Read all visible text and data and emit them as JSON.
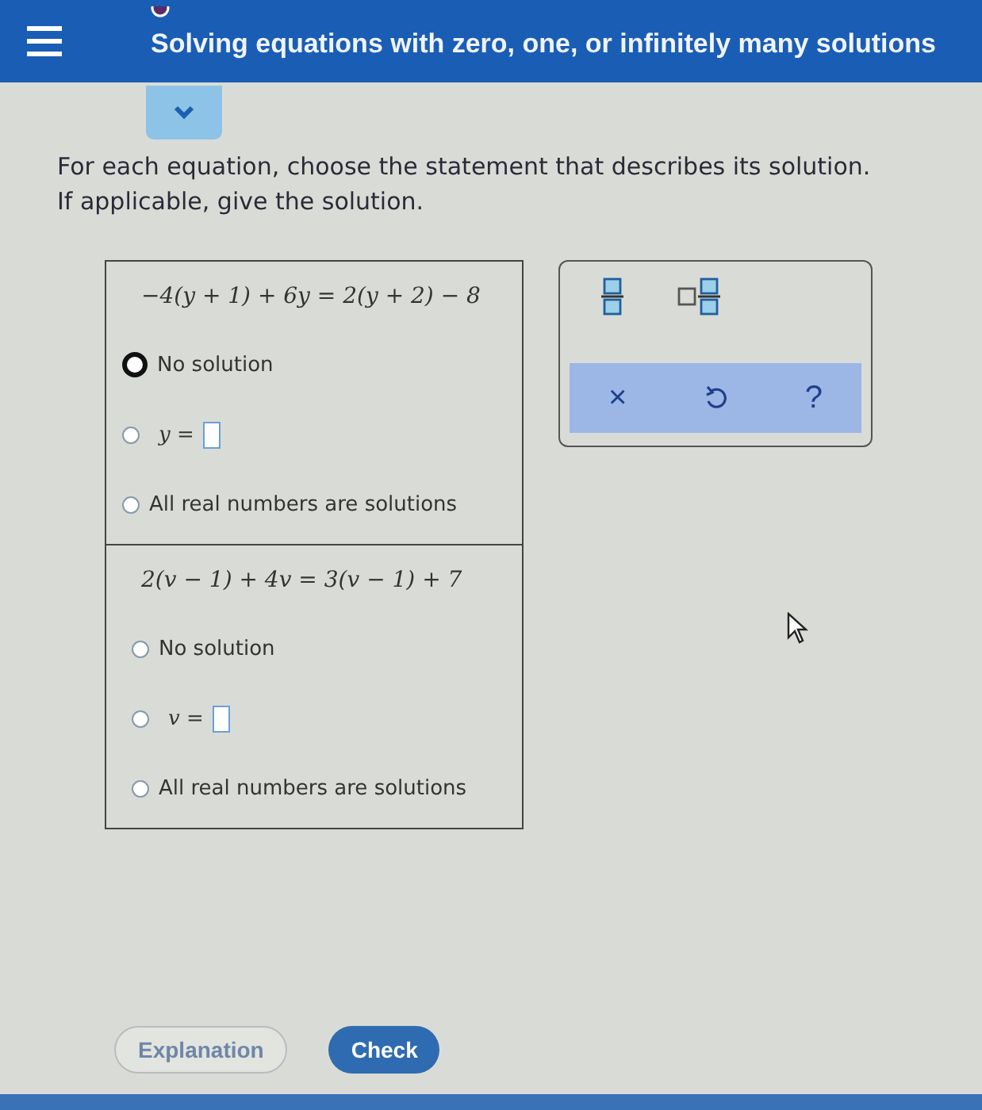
{
  "header": {
    "title": "Solving equations with zero, one, or infinitely many solutions"
  },
  "collapse_toggle": {
    "expanded": false
  },
  "instructions": "For each equation, choose the statement that describes its solution.\nIf applicable, give the solution.",
  "questions": [
    {
      "equation": "−4(y + 1) + 6y = 2(y + 2) − 8",
      "options": [
        {
          "kind": "text",
          "label": "No solution",
          "selected": true
        },
        {
          "kind": "input",
          "label": "*y* =",
          "selected": false
        },
        {
          "kind": "text",
          "label": "All real numbers are solutions",
          "selected": false
        }
      ]
    },
    {
      "equation": "2(v − 1) + 4v = 3(v − 1) + 7",
      "options": [
        {
          "kind": "text",
          "label": "No solution",
          "selected": false
        },
        {
          "kind": "input",
          "label": "*v* =",
          "selected": false
        },
        {
          "kind": "text",
          "label": "All real numbers are solutions",
          "selected": false
        }
      ]
    }
  ],
  "toolbox": {
    "actions": [
      {
        "kind": "clear",
        "label": "×"
      },
      {
        "kind": "undo"
      },
      {
        "kind": "help",
        "label": "?"
      }
    ]
  },
  "buttons": [
    {
      "kind": "secondary",
      "label": "Explanation"
    },
    {
      "kind": "primary",
      "label": "Check"
    }
  ]
}
